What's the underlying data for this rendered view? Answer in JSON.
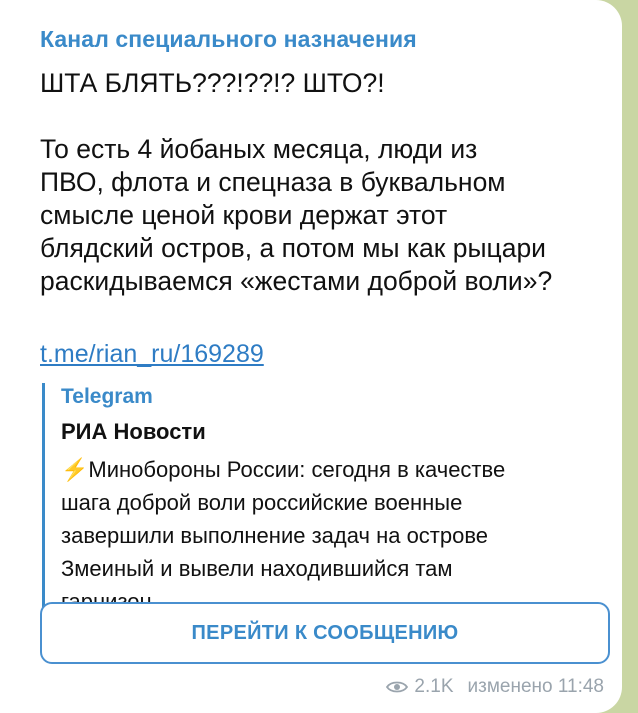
{
  "channel": {
    "name": "Канал специального назначения"
  },
  "message": {
    "text": "ШТА БЛЯТЬ???!??!? ШТО?!\n\nТо есть 4 йобаных месяца, люди из\nПВО, флота и спецназа в буквальном\nсмысле ценой крови держат этот\nблядский остров, а потом мы как рыцари\nраскидываемся «жестами доброй воли»?",
    "link": "t.me/rian_ru/169289"
  },
  "preview": {
    "site": "Telegram",
    "title": "РИА Новости",
    "bolt": "⚡",
    "description": "Минобороны России: сегодня в качестве\nшага доброй воли российские военные\nзавершили выполнение задач на острове\nЗмеиный и вывели находившийся там\nгарнизон"
  },
  "button": {
    "label": "ПЕРЕЙТИ К СООБЩЕНИЮ"
  },
  "meta": {
    "views": "2.1K",
    "edited": "изменено 11:48",
    "icon": "eye-icon"
  },
  "colors": {
    "accent": "#3a8ac9",
    "background": "#c9d6a3"
  }
}
